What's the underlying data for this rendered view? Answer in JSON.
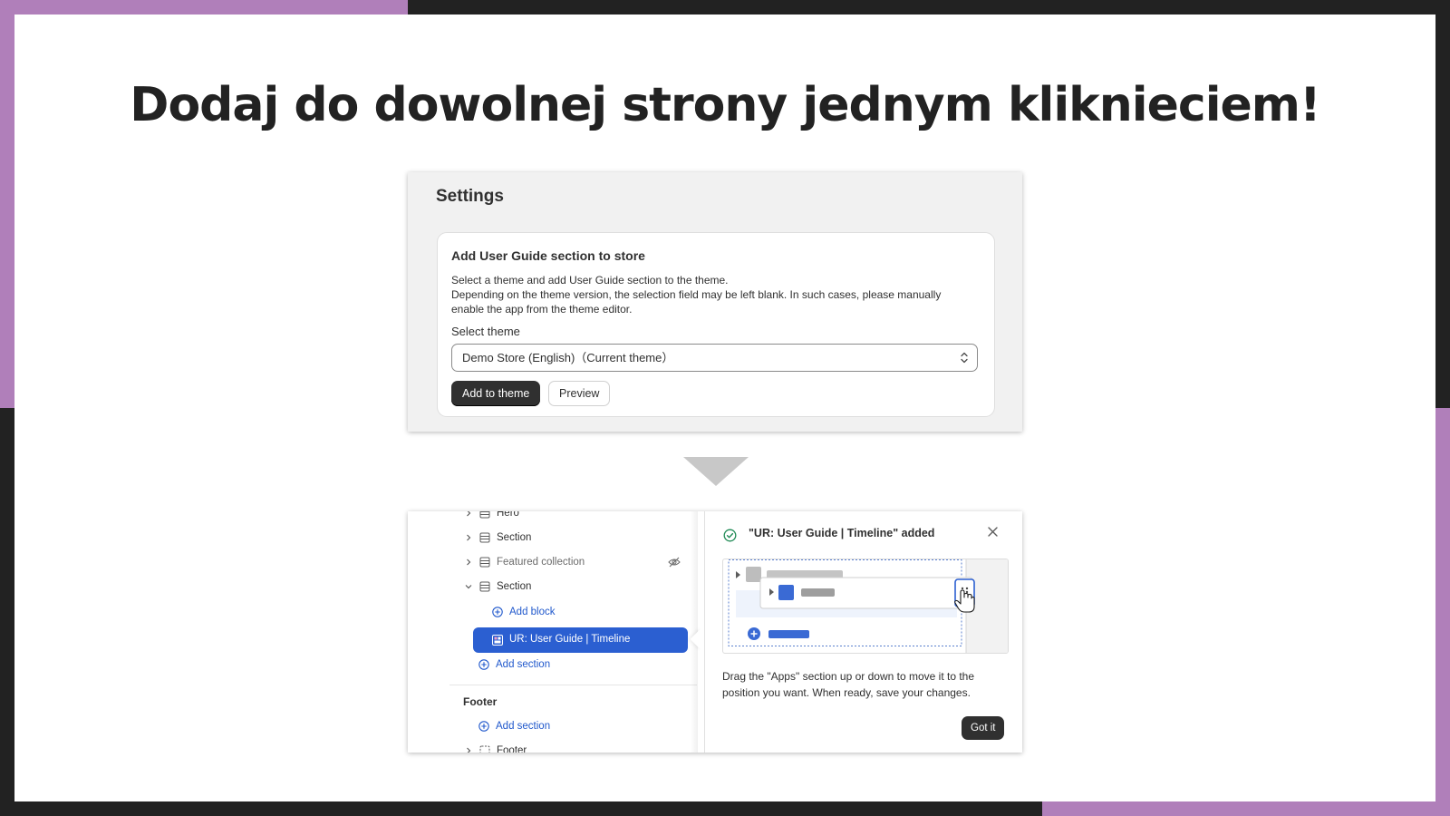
{
  "headline": "Dodaj do dowolnej strony jednym kliknieciem!",
  "settings": {
    "title": "Settings",
    "card": {
      "title": "Add User Guide section to store",
      "description_lines": [
        "Select a theme and add User Guide section to the theme.",
        "Depending on the theme version, the selection field may be left blank. In such cases, please manually",
        "enable the app from the theme editor."
      ],
      "select_label": "Select theme",
      "select_value": "Demo Store (English)（Current theme）",
      "add_button": "Add to theme",
      "preview_button": "Preview"
    }
  },
  "editor": {
    "tree": {
      "items": [
        {
          "label": "Hero"
        },
        {
          "label": "Section"
        },
        {
          "label": "Featured collection",
          "hidden": true
        },
        {
          "label": "Section",
          "expanded": true
        }
      ],
      "add_block": "Add block",
      "selected_item": "UR: User Guide | Timeline",
      "add_section": "Add section",
      "footer_heading": "Footer",
      "footer_add_section": "Add section",
      "footer_item": "Footer"
    },
    "popup": {
      "title": "\"UR: User Guide | Timeline\" added",
      "text_lines": [
        "Drag the \"Apps\" section up or down to move it to the",
        "position you want. When ready, save your changes."
      ],
      "button": "Got it"
    }
  },
  "colors": {
    "accent_purple": "#b07fba",
    "dark_frame": "#222222",
    "selected_blue": "#2b5fd1",
    "link_blue": "#2058cc",
    "success_green": "#1f8a55"
  },
  "icons": [
    "chevron-right-icon",
    "chevron-down-icon",
    "section-icon",
    "eye-off-icon",
    "plus-circle-icon",
    "app-block-icon",
    "check-circle-icon",
    "close-icon",
    "drag-handle-icon",
    "hand-cursor-icon",
    "select-chevron-icon",
    "arrow-down-triangle"
  ]
}
